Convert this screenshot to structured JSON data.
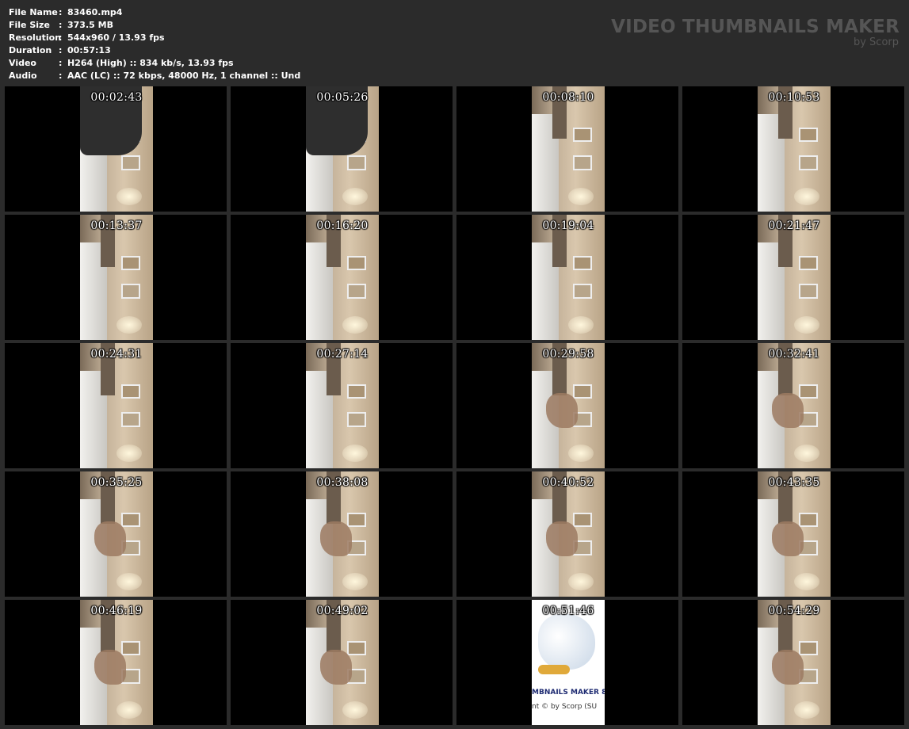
{
  "info": [
    {
      "key": "File Name",
      "value": "83460.mp4"
    },
    {
      "key": "File Size",
      "value": "373.5 MB"
    },
    {
      "key": "Resolution",
      "value": "544x960 / 13.93 fps"
    },
    {
      "key": "Duration",
      "value": "00:57:13"
    },
    {
      "key": "Video",
      "value": "H264 (High) :: 834 kb/s, 13.93 fps"
    },
    {
      "key": "Audio",
      "value": "AAC (LC) :: 72 kbps, 48000 Hz, 1 channel :: Und"
    }
  ],
  "separator": ":",
  "brand": {
    "title": "VIDEO THUMBNAILS MAKER",
    "subtitle": "by Scorp"
  },
  "owl_text": {
    "line1": "MBNAILS MAKER 8",
    "line2": "nt © by Scorp (SU"
  },
  "thumbnails": [
    {
      "time": "00:02:43"
    },
    {
      "time": "00:05:26"
    },
    {
      "time": "00:08:10"
    },
    {
      "time": "00:10:53"
    },
    {
      "time": "00:13:37"
    },
    {
      "time": "00:16:20"
    },
    {
      "time": "00:19:04"
    },
    {
      "time": "00:21:47"
    },
    {
      "time": "00:24:31"
    },
    {
      "time": "00:27:14"
    },
    {
      "time": "00:29:58"
    },
    {
      "time": "00:32:41"
    },
    {
      "time": "00:35:25"
    },
    {
      "time": "00:38:08"
    },
    {
      "time": "00:40:52"
    },
    {
      "time": "00:43:35"
    },
    {
      "time": "00:46:19"
    },
    {
      "time": "00:49:02"
    },
    {
      "time": "00:51:46"
    },
    {
      "time": "00:54:29"
    }
  ],
  "colors": {
    "background": "#2b2b2b",
    "text": "#ffffff",
    "brand": "#555555"
  }
}
